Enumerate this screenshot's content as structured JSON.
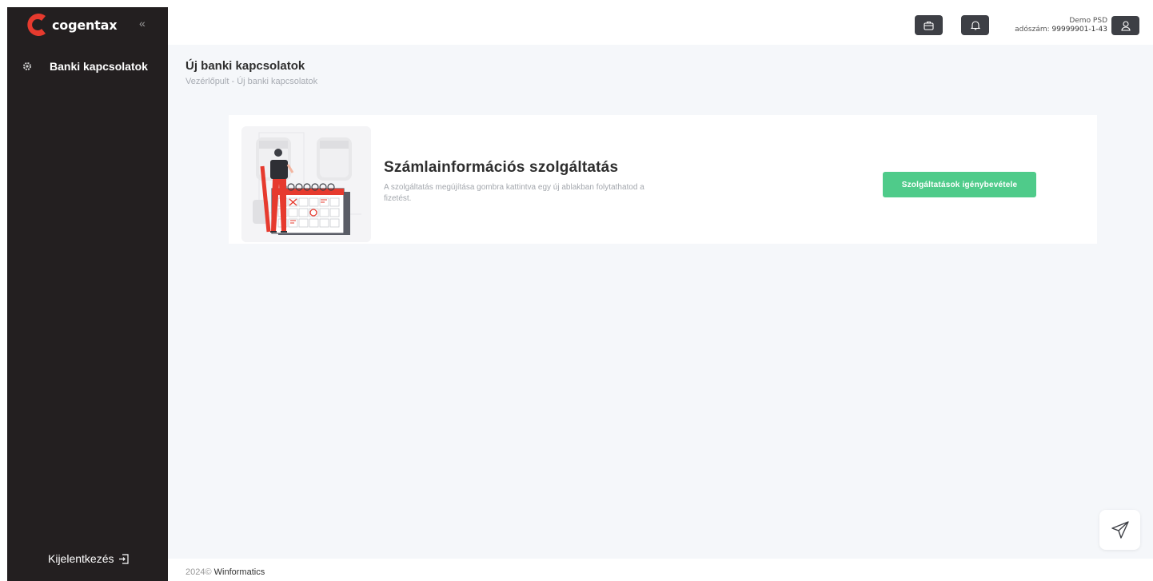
{
  "brand": {
    "name": "cogentax",
    "accent": "#e63a2e"
  },
  "sidebar": {
    "collapse_symbol": "«",
    "items": [
      {
        "label": "Banki kapcsolatok",
        "icon": "gear-icon"
      }
    ],
    "logout_label": "Kijelentkezés"
  },
  "header": {
    "user_name": "Demo PSD",
    "tax_label": "adószám:",
    "tax_number": "99999901-1-43"
  },
  "page": {
    "title": "Új banki kapcsolatok",
    "breadcrumb": "Vezérlőpult - Új banki kapcsolatok"
  },
  "card": {
    "title": "Számlainformációs szolgáltatás",
    "description": "A szolgáltatás megújítása gombra kattintva egy új ablakban folytathatod a fizetést.",
    "button_label": "Szolgáltatások igénybevétele",
    "button_color": "#4fcb8a"
  },
  "footer": {
    "year": "2024©",
    "brand": "Winformatics"
  }
}
